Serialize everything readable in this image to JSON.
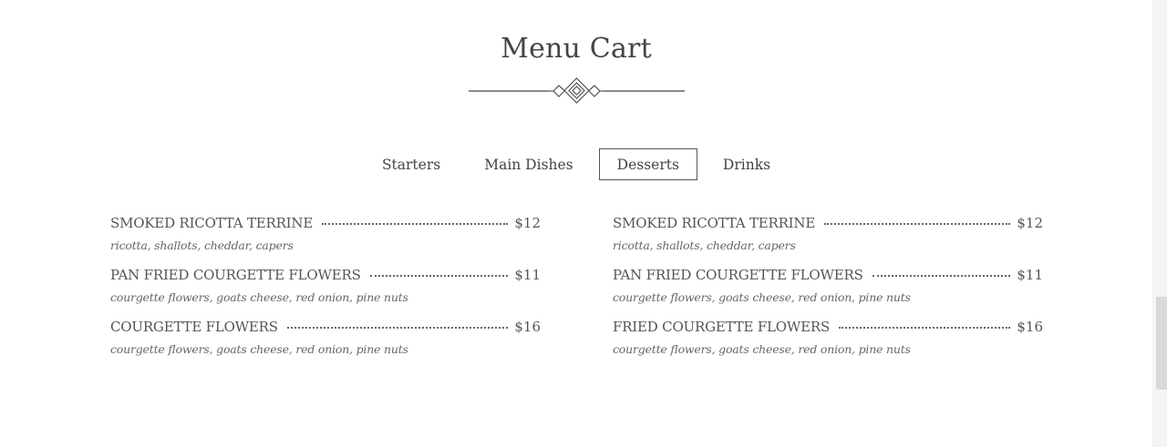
{
  "header": {
    "title": "Menu Cart"
  },
  "tabs": [
    {
      "label": "Starters",
      "active": false
    },
    {
      "label": "Main Dishes",
      "active": false
    },
    {
      "label": "Desserts",
      "active": true
    },
    {
      "label": "Drinks",
      "active": false
    }
  ],
  "menu": {
    "left": [
      {
        "name": "SMOKED RICOTTA TERRINE",
        "price": "$12",
        "desc": "ricotta, shallots, cheddar, capers"
      },
      {
        "name": "PAN FRIED COURGETTE FLOWERS",
        "price": "$11",
        "desc": "courgette flowers, goats cheese, red onion, pine nuts"
      },
      {
        "name": "COURGETTE FLOWERS",
        "price": "$16",
        "desc": "courgette flowers, goats cheese, red onion, pine nuts"
      }
    ],
    "right": [
      {
        "name": "SMOKED RICOTTA TERRINE",
        "price": "$12",
        "desc": "ricotta, shallots, cheddar, capers"
      },
      {
        "name": "PAN FRIED COURGETTE FLOWERS",
        "price": "$11",
        "desc": "courgette flowers, goats cheese, red onion, pine nuts"
      },
      {
        "name": "FRIED COURGETTE FLOWERS",
        "price": "$16",
        "desc": "courgette flowers, goats cheese, red onion, pine nuts"
      }
    ]
  },
  "icons": {
    "ornament": "ornamental-divider-icon"
  }
}
